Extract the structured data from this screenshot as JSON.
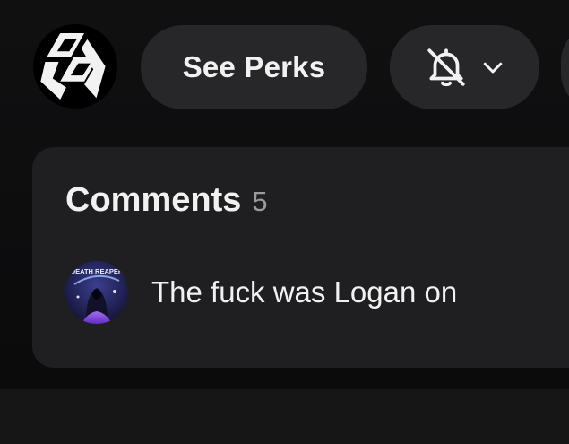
{
  "header": {
    "channel_logo_icon": "geometric-cube-logo-icon",
    "perks_label": "See Perks",
    "notifications": {
      "state_icon": "bell-off-icon",
      "dropdown_icon": "chevron-down-icon"
    }
  },
  "comments": {
    "title": "Comments",
    "count": "5",
    "top_comment": {
      "avatar_text": "DEATH REAPER",
      "text": "The fuck was Logan on"
    }
  },
  "colors": {
    "background": "#0b0b0c",
    "pill": "#27272a",
    "card": "#1f1f21",
    "text": "#f1f1f1",
    "muted": "#9a9a9e"
  }
}
